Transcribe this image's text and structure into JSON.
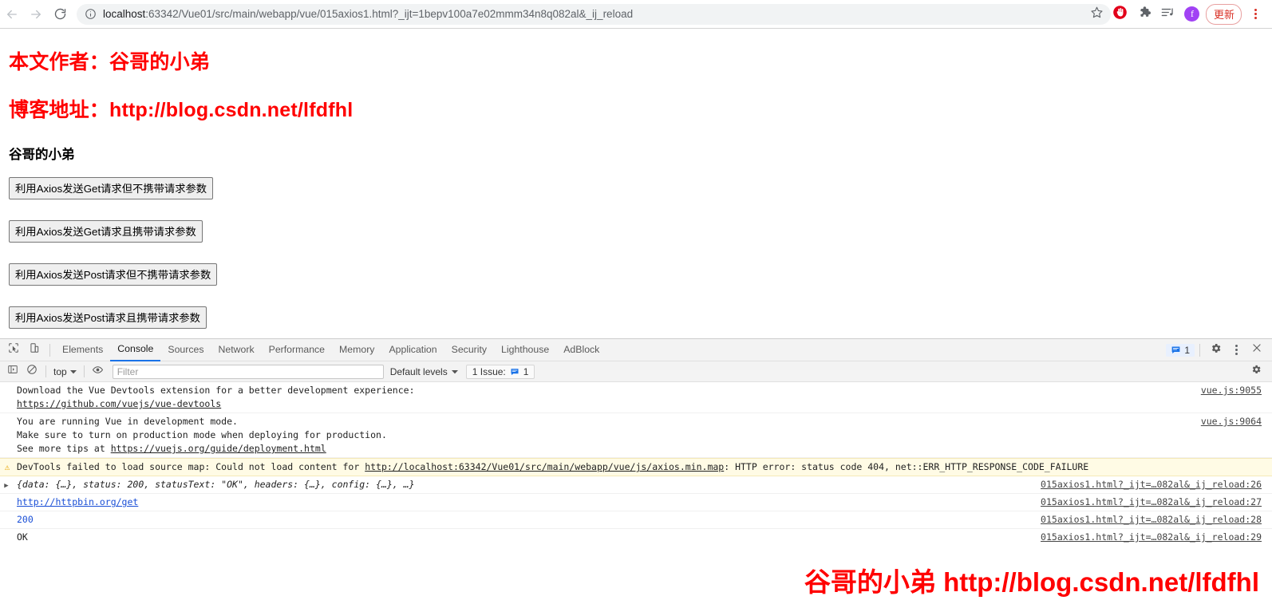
{
  "browser": {
    "back_label": "back-arrow",
    "forward_label": "forward-arrow",
    "reload_label": "reload",
    "url_host": "localhost",
    "url_rest": ":63342/Vue01/src/main/webapp/vue/015axios1.html?_ijt=1bepv100a7e02mmm34n8q082al&_ij_reload",
    "url_full": "localhost:63342/Vue01/src/main/webapp/vue/015axios1.html?_ijt=1bepv100a7e02mmm34n8q082al&_ij_reload",
    "profile_initial": "f",
    "update_label": "更新"
  },
  "page": {
    "author_heading": "本文作者：谷哥的小弟",
    "blog_heading": "博客地址：http://blog.csdn.net/lfdfhl",
    "app_name": "谷哥的小弟",
    "buttons": [
      "利用Axios发送Get请求但不携带请求参数",
      "利用Axios发送Get请求且携带请求参数",
      "利用Axios发送Post请求但不携带请求参数",
      "利用Axios发送Post请求且携带请求参数"
    ]
  },
  "devtools": {
    "tabs": [
      {
        "label": "Elements",
        "active": false
      },
      {
        "label": "Console",
        "active": true
      },
      {
        "label": "Sources",
        "active": false
      },
      {
        "label": "Network",
        "active": false
      },
      {
        "label": "Performance",
        "active": false
      },
      {
        "label": "Memory",
        "active": false
      },
      {
        "label": "Application",
        "active": false
      },
      {
        "label": "Security",
        "active": false
      },
      {
        "label": "Lighthouse",
        "active": false
      },
      {
        "label": "AdBlock",
        "active": false
      }
    ],
    "issues_count": "1",
    "filterbar": {
      "context": "top",
      "filter_placeholder": "Filter",
      "filter_value": "",
      "levels": "Default levels",
      "issue_label": "1 Issue:",
      "issue_count": "1"
    },
    "console": {
      "rows": [
        {
          "type": "info",
          "text_line1": "Download the Vue Devtools extension for a better development experience:",
          "link": "https://github.com/vuejs/vue-devtools",
          "source": "vue.js:9055"
        },
        {
          "type": "info",
          "text_line1": "You are running Vue in development mode.",
          "text_line2": "Make sure to turn on production mode when deploying for production.",
          "text_line3_prefix": "See more tips at ",
          "link": "https://vuejs.org/guide/deployment.html",
          "source": "vue.js:9064"
        },
        {
          "type": "warning",
          "text_prefix": "DevTools failed to load source map: Could not load content for ",
          "link": "http://localhost:63342/Vue01/src/main/webapp/vue/js/axios.min.map",
          "text_suffix": ": HTTP error: status code 404, net::ERR_HTTP_RESPONSE_CODE_FAILURE",
          "source": ""
        },
        {
          "type": "object",
          "text": "{data: {…}, status: 200, statusText: \"OK\", headers: {…}, config: {…}, …}",
          "source": "015axios1.html?_ijt=…082al&_ij_reload:26"
        },
        {
          "type": "link",
          "text": "http://httpbin.org/get",
          "source": "015axios1.html?_ijt=…082al&_ij_reload:27"
        },
        {
          "type": "number",
          "text": "200",
          "source": "015axios1.html?_ijt=…082al&_ij_reload:28"
        },
        {
          "type": "text",
          "text": "OK",
          "source": "015axios1.html?_ijt=…082al&_ij_reload:29"
        }
      ],
      "prompt": ">"
    }
  },
  "watermark": {
    "cn": "谷哥的小弟",
    "url": "http://blog.csdn.net/lfdfhl"
  }
}
